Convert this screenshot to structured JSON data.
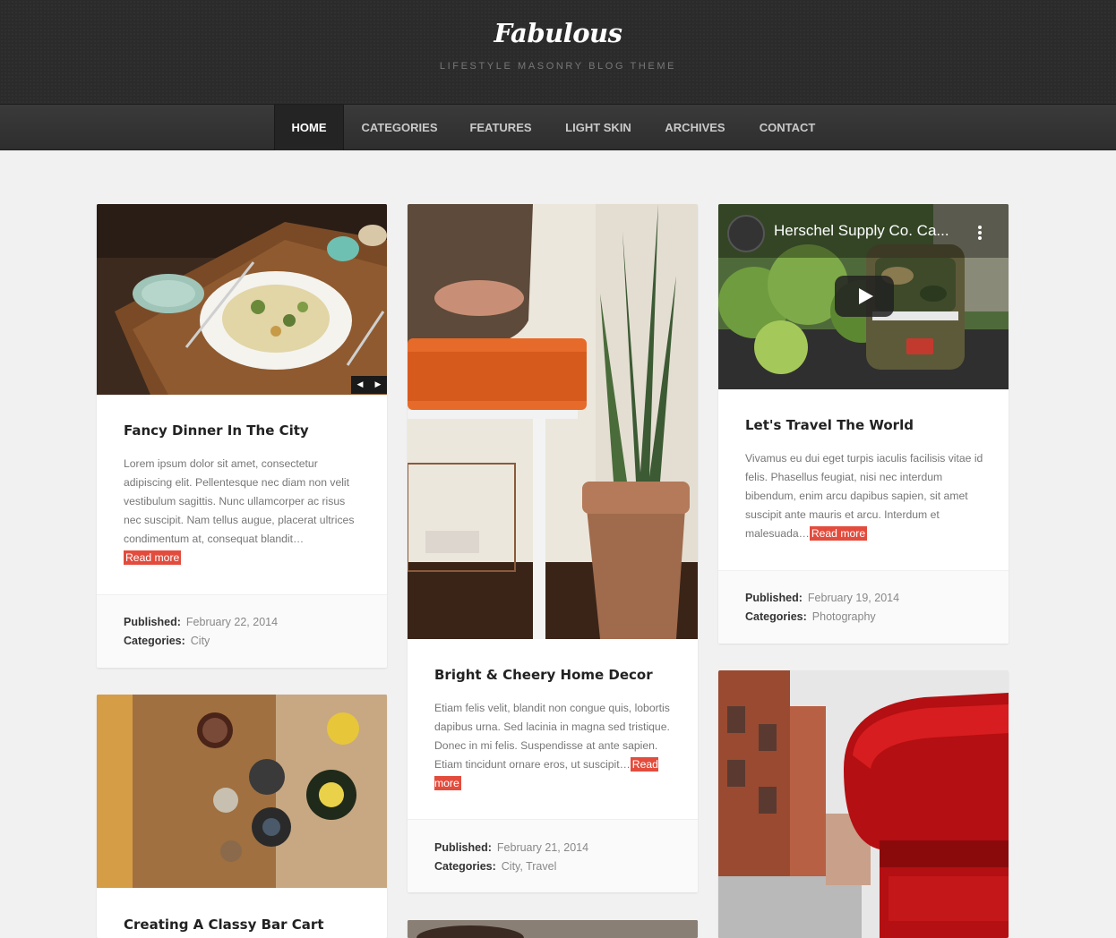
{
  "header": {
    "logo": "Fabulous",
    "tagline": "LIFESTYLE MASONRY BLOG THEME"
  },
  "nav": {
    "items": [
      "HOME",
      "CATEGORIES",
      "FEATURES",
      "LIGHT SKIN",
      "ARCHIVES",
      "CONTACT"
    ],
    "active": "HOME"
  },
  "posts": [
    {
      "title": "Fancy Dinner In The City",
      "excerpt": "Lorem ipsum dolor sit amet, consectetur adipiscing elit. Pellentesque nec diam non velit vestibulum sagittis. Nunc ullamcorper ac risus nec suscipit. Nam tellus augue, placerat ultrices condimentum at, consequat blandit…",
      "read_more": "Read more",
      "published_label": "Published:",
      "published": "February 22, 2014",
      "categories_label": "Categories:",
      "categories": "City"
    },
    {
      "title": "Bright & Cheery Home Decor",
      "excerpt": "Etiam felis velit, blandit non congue quis, lobortis dapibus urna. Sed lacinia in magna sed tristique. Donec in mi felis. Suspendisse at ante sapien. Etiam tincidunt ornare eros, ut suscipit…",
      "read_more": "Read more",
      "published_label": "Published:",
      "published": "February 21, 2014",
      "categories_label": "Categories:",
      "categories": "City, Travel"
    },
    {
      "title": "Let's Travel The World",
      "excerpt": "Vivamus eu dui eget turpis iaculis facilisis vitae id felis. Phasellus feugiat, nisi nec interdum bibendum, enim arcu dapibus sapien, sit amet suscipit ante mauris et arcu. Interdum et malesuada…",
      "read_more": "Read more",
      "published_label": "Published:",
      "published": "February 19, 2014",
      "categories_label": "Categories:",
      "categories": "Photography",
      "video_title": "Herschel Supply Co. Ca..."
    },
    {
      "title": "Creating A Classy Bar Cart"
    }
  ],
  "colors": {
    "accent": "#e34c3d",
    "header_bg": "#2b2b2b",
    "page_bg": "#f1f1f1"
  },
  "icons": {
    "slider_prev": "◀",
    "slider_next": "▶",
    "play": "play-icon",
    "more": "more-vert-icon"
  }
}
